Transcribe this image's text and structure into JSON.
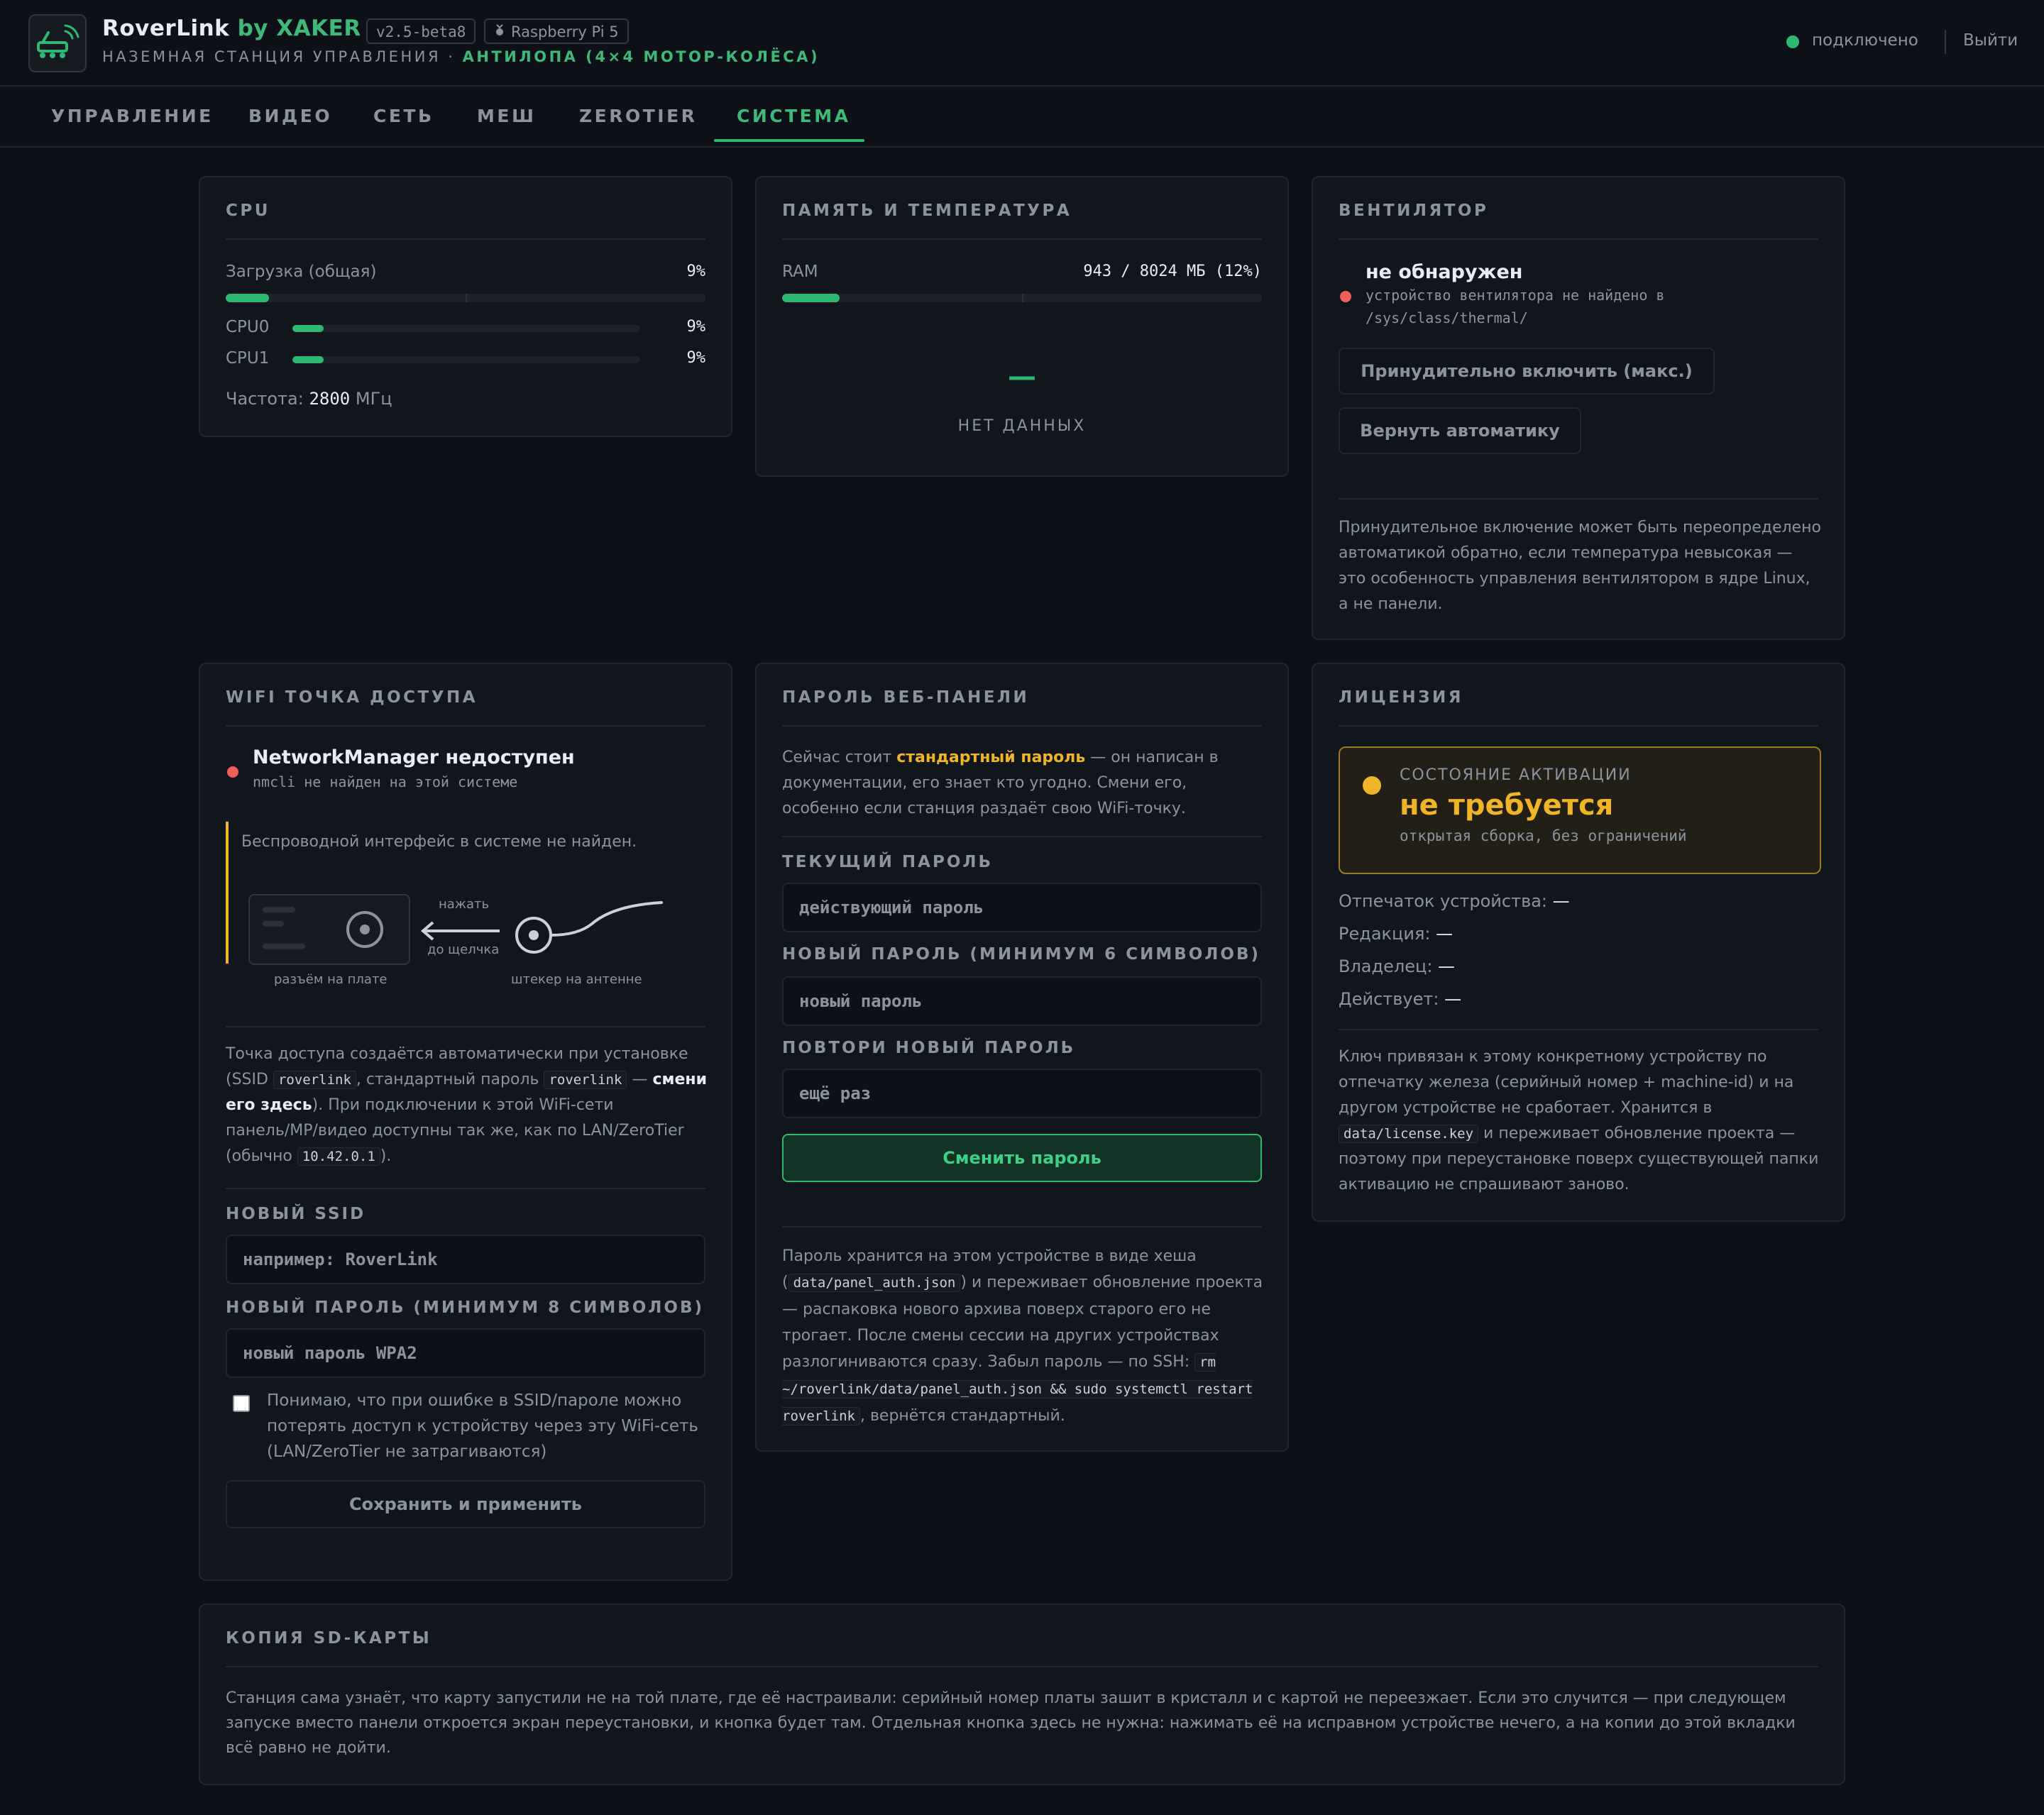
{
  "app": {
    "name": "RoverLink",
    "by": "by XAKER",
    "version": "v2.5-beta8",
    "board": "Raspberry Pi 5",
    "subtitle_prefix": "НАЗЕМНАЯ СТАНЦИЯ УПРАВЛЕНИЯ ·",
    "subtitle_model": "АНТИЛОПА (4×4 МОТОР-КОЛЁСА)",
    "status": "подключено",
    "logout": "Выйти",
    "colors": {
      "accent": "#2fb872",
      "warning": "#f0b429",
      "error": "#f0605a",
      "background": "#0d1117"
    }
  },
  "tabs": [
    {
      "id": "control",
      "label": "УПРАВЛЕНИЕ"
    },
    {
      "id": "video",
      "label": "ВИДЕО"
    },
    {
      "id": "network",
      "label": "СЕТЬ"
    },
    {
      "id": "mesh",
      "label": "МЕШ"
    },
    {
      "id": "zerotier",
      "label": "ZEROTIER"
    },
    {
      "id": "system",
      "label": "СИСТЕМА",
      "active": true
    }
  ],
  "cpu": {
    "title": "CPU",
    "total_label": "Загрузка (общая)",
    "total_value": "9%",
    "total_fraction": 0.09,
    "cores": [
      {
        "name": "CPU0",
        "value": "9%",
        "fraction": 0.09
      },
      {
        "name": "CPU1",
        "value": "9%",
        "fraction": 0.09
      }
    ],
    "freq_label": "Частота:",
    "freq_value": "2800",
    "freq_unit": "МГц"
  },
  "memory": {
    "title": "ПАМЯТЬ И ТЕМПЕРАТУРА",
    "ram_label": "RAM",
    "ram_value": "943 / 8024 МБ (12%)",
    "ram_fraction": 0.12,
    "temp_placeholder": "—",
    "no_data": "НЕТ ДАННЫХ"
  },
  "fan": {
    "title": "ВЕНТИЛЯТОР",
    "status": "не обнаружен",
    "detail_line1": "устройство вентилятора не найдено в",
    "detail_line2": "/sys/class/thermal/",
    "force_button": "Принудительно включить (макс.)",
    "auto_button": "Вернуть автоматику",
    "note": "Принудительное включение может быть переопределено автоматикой обратно, если температура невысокая — это особенность управления вентилятором в ядре Linux, а не панели."
  },
  "wifi": {
    "title": "WIFI ТОЧКА ДОСТУПА",
    "status": "NetworkManager недоступен",
    "detail": "nmcli не найден на этой системе",
    "warning": "Беспроводной интерфейс в системе не найден.",
    "diagram": {
      "press": "нажать",
      "until_click": "до щелчка",
      "board_connector": "разъём на плате",
      "antenna_plug": "штекер на антенне"
    },
    "info": {
      "p1": "Точка доступа создаётся автоматически при установке (SSID ",
      "ssid": "roverlink",
      "p2": ", стандартный пароль ",
      "password": "roverlink",
      "p3": " — ",
      "change_here": "смени его здесь",
      "p4": "). При подключении к этой WiFi-сети панель/MP/видео доступны так же, как по LAN/ZeroTier (обычно ",
      "ip": "10.42.0.1",
      "p5": ")."
    },
    "ssid_label": "НОВЫЙ SSID",
    "ssid_placeholder": "например: RoverLink",
    "pass_label": "НОВЫЙ ПАРОЛЬ (МИНИМУМ 8 СИМВОЛОВ)",
    "pass_placeholder": "новый пароль WPA2",
    "confirm_text": "Понимаю, что при ошибке в SSID/пароле можно потерять доступ к устройству через эту WiFi-сеть (LAN/ZeroTier не затрагиваются)",
    "save_button": "Сохранить и применить"
  },
  "panel_password": {
    "title": "ПАРОЛЬ ВЕБ-ПАНЕЛИ",
    "intro_p1": "Сейчас стоит ",
    "intro_highlight": "стандартный пароль",
    "intro_p2": " — он написан в документации, его знает кто угодно. Смени его, особенно если станция раздаёт свою WiFi-точку.",
    "current_label": "ТЕКУЩИЙ ПАРОЛЬ",
    "current_placeholder": "действующий пароль",
    "new_label": "НОВЫЙ ПАРОЛЬ (МИНИМУМ 6 СИМВОЛОВ)",
    "new_placeholder": "новый пароль",
    "repeat_label": "ПОВТОРИ НОВЫЙ ПАРОЛЬ",
    "repeat_placeholder": "ещё раз",
    "change_button": "Сменить пароль",
    "note_p1": "Пароль хранится на этом устройстве в виде хеша (",
    "note_file": "data/panel_auth.json",
    "note_p2": ") и переживает обновление проекта — распаковка нового архива поверх старого его не трогает. После смены сессии на других устройствах разлогиниваются сразу. Забыл пароль — по SSH: ",
    "note_cmd": "rm ~/roverlink/data/panel_auth.json && sudo systemctl restart roverlink",
    "note_p3": ", вернётся стандартный."
  },
  "license": {
    "title": "ЛИЦЕНЗИЯ",
    "state_label": "СОСТОЯНИЕ АКТИВАЦИИ",
    "state_value": "не требуется",
    "state_detail": "открытая сборка, без ограничений",
    "rows": [
      {
        "label": "Отпечаток устройства:",
        "value": "—"
      },
      {
        "label": "Редакция:",
        "value": "—"
      },
      {
        "label": "Владелец:",
        "value": "—"
      },
      {
        "label": "Действует:",
        "value": "—"
      }
    ],
    "note_p1": "Ключ привязан к этому конкретному устройству по отпечатку железа (серийный номер + machine-id) и на другом устройстве не сработает. Хранится в ",
    "note_file": "data/license.key",
    "note_p2": " и переживает обновление проекта — поэтому при переустановке поверх существующей папки активацию не спрашивают заново."
  },
  "sd_copy": {
    "title": "КОПИЯ SD-КАРТЫ",
    "text": "Станция сама узнаёт, что карту запустили не на той плате, где её настраивали: серийный номер платы зашит в кристалл и с картой не переезжает. Если это случится — при следующем запуске вместо панели откроется экран переустановки, и кнопка будет там. Отдельная кнопка здесь не нужна: нажимать её на исправном устройстве нечего, а на копии до этой вкладки всё равно не дойти."
  }
}
